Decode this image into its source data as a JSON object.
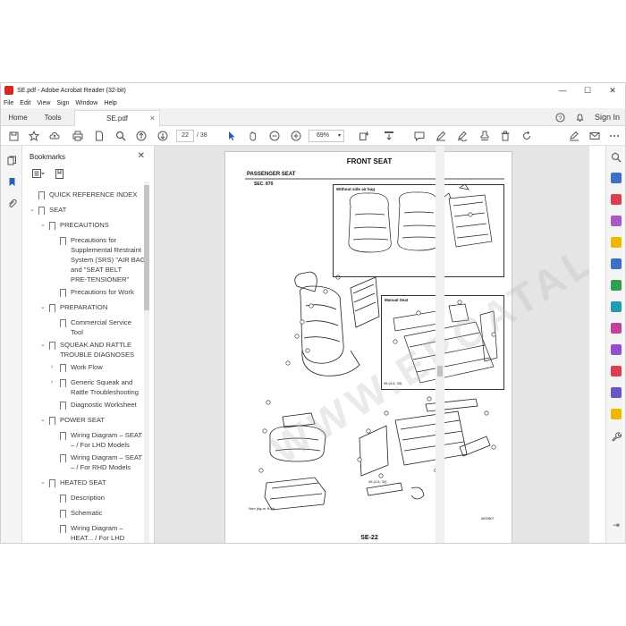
{
  "window": {
    "title": "SE.pdf - Adobe Acrobat Reader (32-bit)",
    "minimize": "—",
    "maximize": "☐",
    "close": "✕"
  },
  "menu": [
    "File",
    "Edit",
    "View",
    "Sign",
    "Window",
    "Help"
  ],
  "tabs": {
    "home": "Home",
    "tools": "Tools",
    "doc": "SE.pdf",
    "close": "×",
    "signin": "Sign In"
  },
  "toolbar": {
    "page_current": "22",
    "page_total": "/ 38",
    "zoom": "69%"
  },
  "bookmarks": {
    "title": "Bookmarks",
    "close": "✕",
    "items": [
      {
        "label": "QUICK REFERENCE INDEX",
        "arrow": ""
      },
      {
        "label": "SEAT",
        "arrow": "⌄"
      },
      {
        "label": "PRECAUTIONS",
        "arrow": "⌄"
      },
      {
        "label": "Precautions for",
        "arrow": ""
      },
      {
        "label": "Supplemental Restraint",
        "arrow": ""
      },
      {
        "label": "System (SRS) \"AIR BAG\"",
        "arrow": ""
      },
      {
        "label": "and \"SEAT BELT",
        "arrow": ""
      },
      {
        "label": "PRE-TENSIONER\"",
        "arrow": ""
      },
      {
        "label": "Precautions for Work",
        "arrow": ""
      },
      {
        "label": "PREPARATION",
        "arrow": "⌄"
      },
      {
        "label": "Commercial Service",
        "arrow": ""
      },
      {
        "label": "Tool",
        "arrow": ""
      },
      {
        "label": "SQUEAK AND RATTLE",
        "arrow": "⌄"
      },
      {
        "label": "TROUBLE DIAGNOSES",
        "arrow": ""
      },
      {
        "label": "Work Flow",
        "arrow": "›"
      },
      {
        "label": "Generic Squeak and",
        "arrow": "›"
      },
      {
        "label": "Rattle Troubleshooting",
        "arrow": ""
      },
      {
        "label": "Diagnostic Worksheet",
        "arrow": ""
      },
      {
        "label": "POWER SEAT",
        "arrow": "⌄"
      },
      {
        "label": "Wiring Diagram – SEAT",
        "arrow": ""
      },
      {
        "label": "– / For LHD Models",
        "arrow": ""
      },
      {
        "label": "Wiring Diagram – SEAT",
        "arrow": ""
      },
      {
        "label": "– / For RHD Models",
        "arrow": ""
      },
      {
        "label": "HEATED SEAT",
        "arrow": "⌄"
      },
      {
        "label": "Description",
        "arrow": ""
      },
      {
        "label": "Schematic",
        "arrow": ""
      },
      {
        "label": "Wiring Diagram –",
        "arrow": ""
      },
      {
        "label": "HEAT... / For LHD",
        "arrow": ""
      }
    ]
  },
  "page": {
    "title": "FRONT SEAT",
    "subtitle": "PASSENGER SEAT",
    "section": "SEC. 870",
    "box1_label": "Without side air bag",
    "box2_label": "Manual Seat",
    "legend_box": "45 (4.6, 33)",
    "legend_main": "N•m (kg-m, ft-lb)",
    "legend_lower": "45 (4.6, 33)",
    "figure_id": "AIIS0807",
    "footer": "SE-22",
    "watermark": "WWW.EPCATALO.COM"
  },
  "icons": {
    "save": "save-icon",
    "bookmark_add": "star-icon",
    "upload": "cloud-upload-icon",
    "print": "print-icon",
    "find": "find-icon"
  }
}
